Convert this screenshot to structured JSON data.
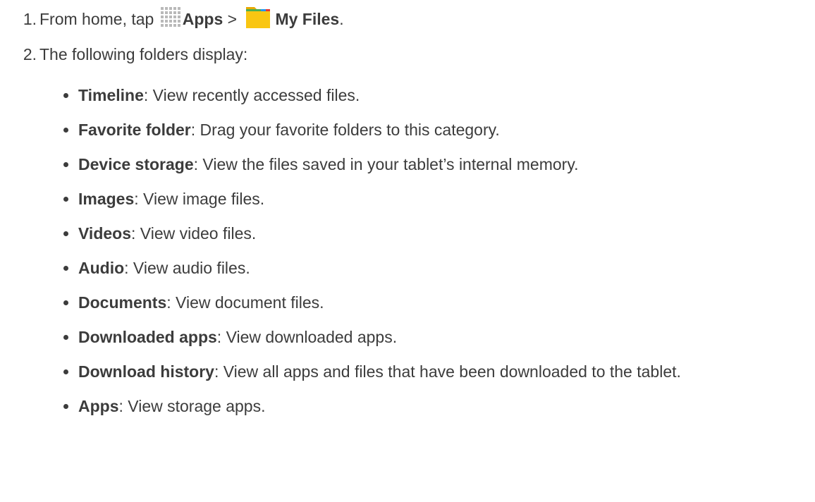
{
  "steps": [
    {
      "num": "1.",
      "text_before": "From home, tap ",
      "apps_icon": "apps-grid-icon",
      "apps_label": "Apps",
      "separator": " > ",
      "files_icon": "folder-icon",
      "files_label": "My Files",
      "end": "."
    },
    {
      "num": "2.",
      "text": "The following folders display:"
    }
  ],
  "folders": [
    {
      "name": "Timeline",
      "desc": ": View recently accessed files."
    },
    {
      "name": "Favorite folder",
      "desc": ": Drag your favorite folders to this category."
    },
    {
      "name": "Device storage",
      "desc": ": View the files saved in your tablet’s internal memory."
    },
    {
      "name": "Images",
      "desc": ": View image files."
    },
    {
      "name": "Videos",
      "desc": ": View video files."
    },
    {
      "name": "Audio",
      "desc": ": View audio files."
    },
    {
      "name": "Documents",
      "desc": ": View document files."
    },
    {
      "name": "Downloaded apps",
      "desc": ": View downloaded apps."
    },
    {
      "name": "Download history",
      "desc": ": View all apps and files that have been downloaded to the tablet."
    },
    {
      "name": "Apps",
      "desc": ": View storage apps."
    }
  ],
  "colors": {
    "text": "#3c3c3c",
    "apps_icon": "#b9b9b9",
    "folder_yellow": "#f9c612"
  }
}
